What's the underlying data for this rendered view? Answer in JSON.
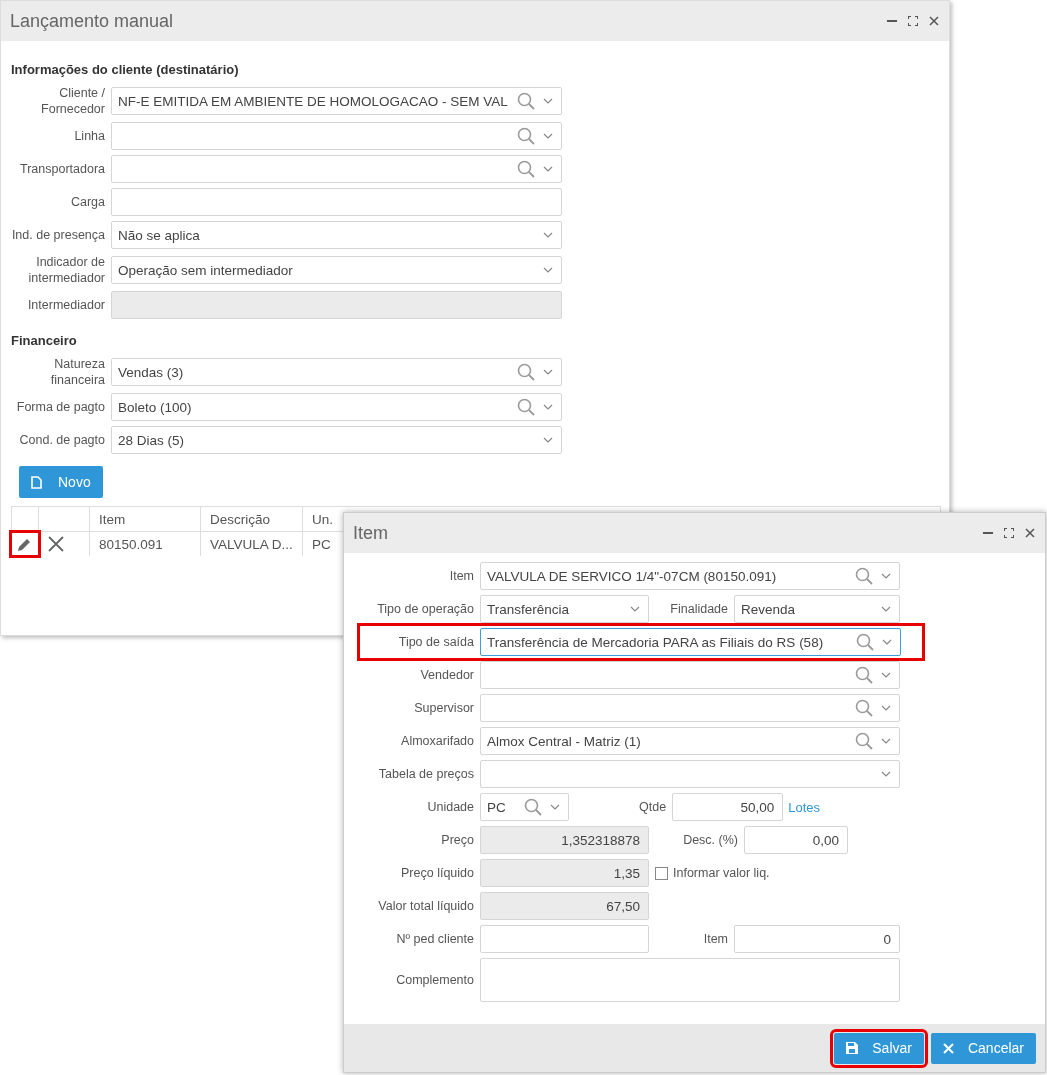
{
  "main_window": {
    "title": "Lançamento manual",
    "sections": [
      {
        "title": "Informações do cliente (destinatário)",
        "fields": [
          {
            "label": "Cliente / Fornecedor",
            "kind": "lookup",
            "value": "NF-E EMITIDA EM AMBIENTE DE HOMOLOGACAO - SEM VAL"
          },
          {
            "label": "Linha",
            "kind": "lookup"
          },
          {
            "label": "Transportadora",
            "kind": "lookup"
          },
          {
            "label": "Carga",
            "kind": "text"
          },
          {
            "label": "Ind. de presença",
            "kind": "select",
            "value": "Não se aplica"
          },
          {
            "label": "Indicador de intermediador",
            "kind": "select",
            "value": "Operação sem intermediador"
          },
          {
            "label": "Intermediador",
            "kind": "readonly"
          }
        ]
      },
      {
        "title": "Financeiro",
        "fields": [
          {
            "label": "Natureza financeira",
            "kind": "lookup",
            "value": "Vendas (3)"
          },
          {
            "label": "Forma de pagto",
            "kind": "lookup",
            "value": "Boleto (100)"
          },
          {
            "label": "Cond. de pagto",
            "kind": "select",
            "value": "28 Dias (5)"
          }
        ]
      }
    ],
    "new_button": "Novo",
    "table": {
      "columns": [
        "Item",
        "Descrição",
        "Un."
      ],
      "rows": [
        {
          "cells": [
            "80150.091",
            "VALVULA D...",
            "PC"
          ],
          "highlighted": true
        }
      ]
    }
  },
  "item_dialog": {
    "title": "Item",
    "rows": [
      {
        "kind": "full",
        "label": "Item",
        "field": {
          "kind": "lookup",
          "value": "VALVULA DE SERVICO 1/4\"-07CM (80150.091)"
        }
      },
      {
        "kind": "split",
        "label": "Tipo de operação",
        "field": {
          "kind": "select",
          "value": "Transferência"
        },
        "right": {
          "label": "Finalidade",
          "field": {
            "kind": "select",
            "value": "Revenda"
          }
        }
      },
      {
        "kind": "full",
        "label": "Tipo de saída",
        "highlighted": true,
        "field": {
          "kind": "lookup",
          "value": "Transferência de Mercadoria PARA as Filiais do RS (58)",
          "focused": true
        }
      },
      {
        "kind": "full",
        "label": "Vendedor",
        "field": {
          "kind": "lookup"
        }
      },
      {
        "kind": "full",
        "label": "Supervisor",
        "field": {
          "kind": "lookup"
        }
      },
      {
        "kind": "full",
        "label": "Almoxarifado",
        "field": {
          "kind": "lookup",
          "value": "Almox Central - Matriz (1)"
        }
      },
      {
        "kind": "full",
        "label": "Tabela de preços",
        "field": {
          "kind": "select"
        }
      },
      {
        "kind": "unit",
        "label": "Unidade",
        "field": {
          "kind": "lookup",
          "value": "PC"
        },
        "right": {
          "label": "Qtde",
          "field": {
            "kind": "number",
            "value": "50,00"
          }
        },
        "link": "Lotes"
      },
      {
        "kind": "price",
        "label": "Preço",
        "field": {
          "kind": "readonly",
          "value": "1,352318878"
        },
        "right": {
          "label": "Desc. (%)",
          "field": {
            "kind": "number",
            "value": "0,00"
          }
        }
      },
      {
        "kind": "check",
        "label": "Preço líquido",
        "field": {
          "kind": "readonly",
          "value": "1,35"
        },
        "checkbox": {
          "label": "Informar valor liq.",
          "checked": false
        }
      },
      {
        "kind": "check",
        "label": "Valor total líquido",
        "field": {
          "kind": "readonly",
          "value": "67,50"
        }
      },
      {
        "kind": "split",
        "label": "Nº ped cliente",
        "field": {
          "kind": "text"
        },
        "right": {
          "label": "Item",
          "field": {
            "kind": "number",
            "value": "0"
          }
        }
      },
      {
        "kind": "area",
        "label": "Complemento",
        "field": {
          "kind": "textarea"
        }
      }
    ],
    "buttons": [
      {
        "kind": "save",
        "label": "Salvar",
        "highlighted": true
      },
      {
        "kind": "cancel",
        "label": "Cancelar",
        "highlighted": false
      }
    ]
  }
}
